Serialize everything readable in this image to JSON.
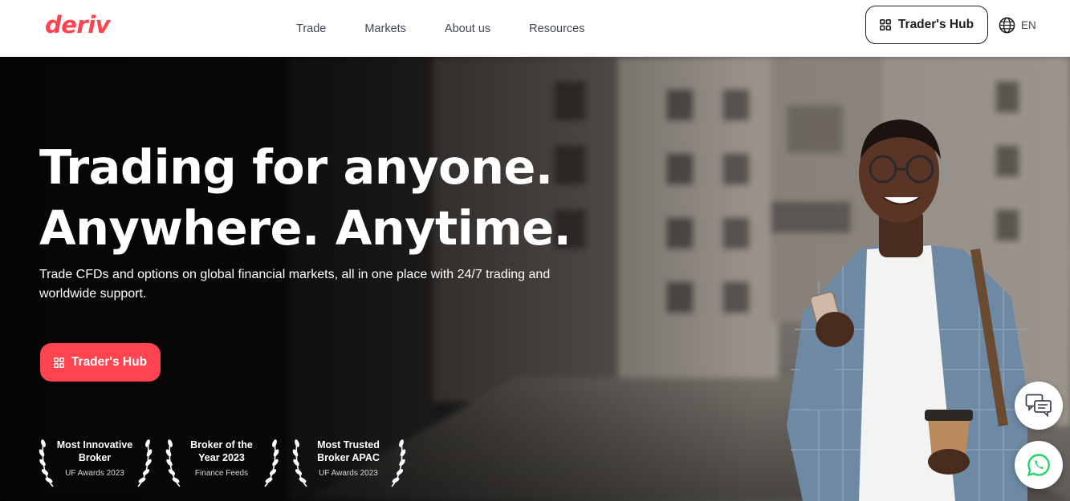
{
  "brand": {
    "logo_text": "deriv",
    "accent": "#ff444f"
  },
  "nav": {
    "items": [
      {
        "label": "Trade"
      },
      {
        "label": "Markets"
      },
      {
        "label": "About us"
      },
      {
        "label": "Resources"
      }
    ]
  },
  "header": {
    "hub_button_label": "Trader's Hub",
    "language": "EN"
  },
  "hero": {
    "title_line1": "Trading for anyone.",
    "title_line2": "Anywhere. Anytime.",
    "subtitle": "Trade CFDs and options on global financial markets, all in one place with 24/7 trading and worldwide support.",
    "cta_label": "Trader's Hub"
  },
  "awards": [
    {
      "title": "Most Innovative Broker",
      "source": "UF Awards 2023"
    },
    {
      "title": "Broker of the Year 2023",
      "source": "Finance Feeds"
    },
    {
      "title": "Most Trusted Broker APAC",
      "source": "UF Awards 2023"
    }
  ],
  "icons": {
    "hub": "grid-icon",
    "language": "globe-icon",
    "chat": "chat-icon",
    "whatsapp": "whatsapp-icon"
  }
}
